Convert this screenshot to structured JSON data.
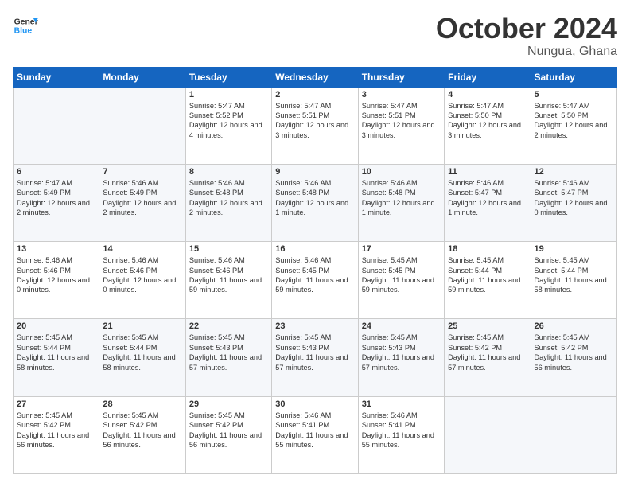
{
  "logo": {
    "line1": "General",
    "line2": "Blue"
  },
  "title": "October 2024",
  "location": "Nungua, Ghana",
  "days_of_week": [
    "Sunday",
    "Monday",
    "Tuesday",
    "Wednesday",
    "Thursday",
    "Friday",
    "Saturday"
  ],
  "weeks": [
    [
      {
        "day": "",
        "text": ""
      },
      {
        "day": "",
        "text": ""
      },
      {
        "day": "1",
        "text": "Sunrise: 5:47 AM\nSunset: 5:52 PM\nDaylight: 12 hours and 4 minutes."
      },
      {
        "day": "2",
        "text": "Sunrise: 5:47 AM\nSunset: 5:51 PM\nDaylight: 12 hours and 3 minutes."
      },
      {
        "day": "3",
        "text": "Sunrise: 5:47 AM\nSunset: 5:51 PM\nDaylight: 12 hours and 3 minutes."
      },
      {
        "day": "4",
        "text": "Sunrise: 5:47 AM\nSunset: 5:50 PM\nDaylight: 12 hours and 3 minutes."
      },
      {
        "day": "5",
        "text": "Sunrise: 5:47 AM\nSunset: 5:50 PM\nDaylight: 12 hours and 2 minutes."
      }
    ],
    [
      {
        "day": "6",
        "text": "Sunrise: 5:47 AM\nSunset: 5:49 PM\nDaylight: 12 hours and 2 minutes."
      },
      {
        "day": "7",
        "text": "Sunrise: 5:46 AM\nSunset: 5:49 PM\nDaylight: 12 hours and 2 minutes."
      },
      {
        "day": "8",
        "text": "Sunrise: 5:46 AM\nSunset: 5:48 PM\nDaylight: 12 hours and 2 minutes."
      },
      {
        "day": "9",
        "text": "Sunrise: 5:46 AM\nSunset: 5:48 PM\nDaylight: 12 hours and 1 minute."
      },
      {
        "day": "10",
        "text": "Sunrise: 5:46 AM\nSunset: 5:48 PM\nDaylight: 12 hours and 1 minute."
      },
      {
        "day": "11",
        "text": "Sunrise: 5:46 AM\nSunset: 5:47 PM\nDaylight: 12 hours and 1 minute."
      },
      {
        "day": "12",
        "text": "Sunrise: 5:46 AM\nSunset: 5:47 PM\nDaylight: 12 hours and 0 minutes."
      }
    ],
    [
      {
        "day": "13",
        "text": "Sunrise: 5:46 AM\nSunset: 5:46 PM\nDaylight: 12 hours and 0 minutes."
      },
      {
        "day": "14",
        "text": "Sunrise: 5:46 AM\nSunset: 5:46 PM\nDaylight: 12 hours and 0 minutes."
      },
      {
        "day": "15",
        "text": "Sunrise: 5:46 AM\nSunset: 5:46 PM\nDaylight: 11 hours and 59 minutes."
      },
      {
        "day": "16",
        "text": "Sunrise: 5:46 AM\nSunset: 5:45 PM\nDaylight: 11 hours and 59 minutes."
      },
      {
        "day": "17",
        "text": "Sunrise: 5:45 AM\nSunset: 5:45 PM\nDaylight: 11 hours and 59 minutes."
      },
      {
        "day": "18",
        "text": "Sunrise: 5:45 AM\nSunset: 5:44 PM\nDaylight: 11 hours and 59 minutes."
      },
      {
        "day": "19",
        "text": "Sunrise: 5:45 AM\nSunset: 5:44 PM\nDaylight: 11 hours and 58 minutes."
      }
    ],
    [
      {
        "day": "20",
        "text": "Sunrise: 5:45 AM\nSunset: 5:44 PM\nDaylight: 11 hours and 58 minutes."
      },
      {
        "day": "21",
        "text": "Sunrise: 5:45 AM\nSunset: 5:44 PM\nDaylight: 11 hours and 58 minutes."
      },
      {
        "day": "22",
        "text": "Sunrise: 5:45 AM\nSunset: 5:43 PM\nDaylight: 11 hours and 57 minutes."
      },
      {
        "day": "23",
        "text": "Sunrise: 5:45 AM\nSunset: 5:43 PM\nDaylight: 11 hours and 57 minutes."
      },
      {
        "day": "24",
        "text": "Sunrise: 5:45 AM\nSunset: 5:43 PM\nDaylight: 11 hours and 57 minutes."
      },
      {
        "day": "25",
        "text": "Sunrise: 5:45 AM\nSunset: 5:42 PM\nDaylight: 11 hours and 57 minutes."
      },
      {
        "day": "26",
        "text": "Sunrise: 5:45 AM\nSunset: 5:42 PM\nDaylight: 11 hours and 56 minutes."
      }
    ],
    [
      {
        "day": "27",
        "text": "Sunrise: 5:45 AM\nSunset: 5:42 PM\nDaylight: 11 hours and 56 minutes."
      },
      {
        "day": "28",
        "text": "Sunrise: 5:45 AM\nSunset: 5:42 PM\nDaylight: 11 hours and 56 minutes."
      },
      {
        "day": "29",
        "text": "Sunrise: 5:45 AM\nSunset: 5:42 PM\nDaylight: 11 hours and 56 minutes."
      },
      {
        "day": "30",
        "text": "Sunrise: 5:46 AM\nSunset: 5:41 PM\nDaylight: 11 hours and 55 minutes."
      },
      {
        "day": "31",
        "text": "Sunrise: 5:46 AM\nSunset: 5:41 PM\nDaylight: 11 hours and 55 minutes."
      },
      {
        "day": "",
        "text": ""
      },
      {
        "day": "",
        "text": ""
      }
    ]
  ]
}
